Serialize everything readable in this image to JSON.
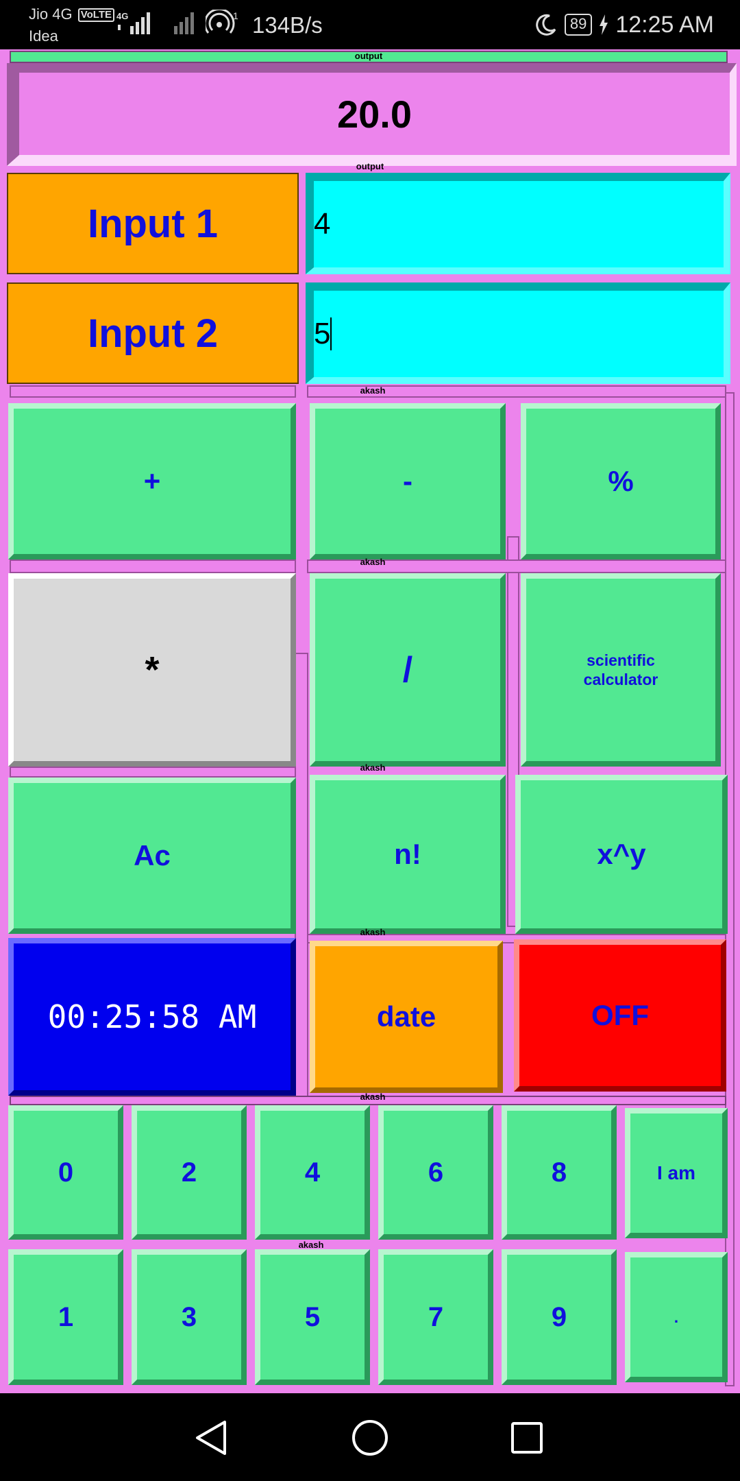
{
  "status_bar": {
    "carrier_primary": "Jio 4G",
    "volte_badge": "VoLTE",
    "carrier_secondary": "Idea",
    "network_type": "4G",
    "hotspot_count": "1",
    "net_speed": "134B/s",
    "battery_level": "89",
    "clock": "12:25 AM"
  },
  "strips": {
    "output_top": "output",
    "output_bottom": "output",
    "row_label": "akash"
  },
  "output": {
    "value": "20.0"
  },
  "inputs": [
    {
      "label": "Input 1",
      "value": "4"
    },
    {
      "label": "Input 2",
      "value": "5"
    }
  ],
  "operations": {
    "add": "+",
    "subtract": "-",
    "percent": "%",
    "multiply": "*",
    "divide": "/",
    "scientific_line1": "scientific",
    "scientific_line2": "calculator",
    "clear": "Ac",
    "factorial": "n!",
    "power": "x^y",
    "clock_display": "00:25:58 AM",
    "date": "date",
    "off": "OFF"
  },
  "keypad": {
    "row1": [
      "0",
      "2",
      "4",
      "6",
      "8",
      "I am"
    ],
    "row2": [
      "1",
      "3",
      "5",
      "7",
      "9",
      "."
    ]
  },
  "colors": {
    "app_background": "#ec84ec",
    "button_green": "#52e892",
    "button_text": "#1010dd",
    "input_field": "#00ffff",
    "input_label": "#ffa500",
    "off_button": "#ff0000",
    "clock_button": "#0000ee"
  },
  "nav_bar": {
    "back_icon": "triangle-back-icon",
    "home_icon": "circle-home-icon",
    "recents_icon": "square-recents-icon"
  }
}
